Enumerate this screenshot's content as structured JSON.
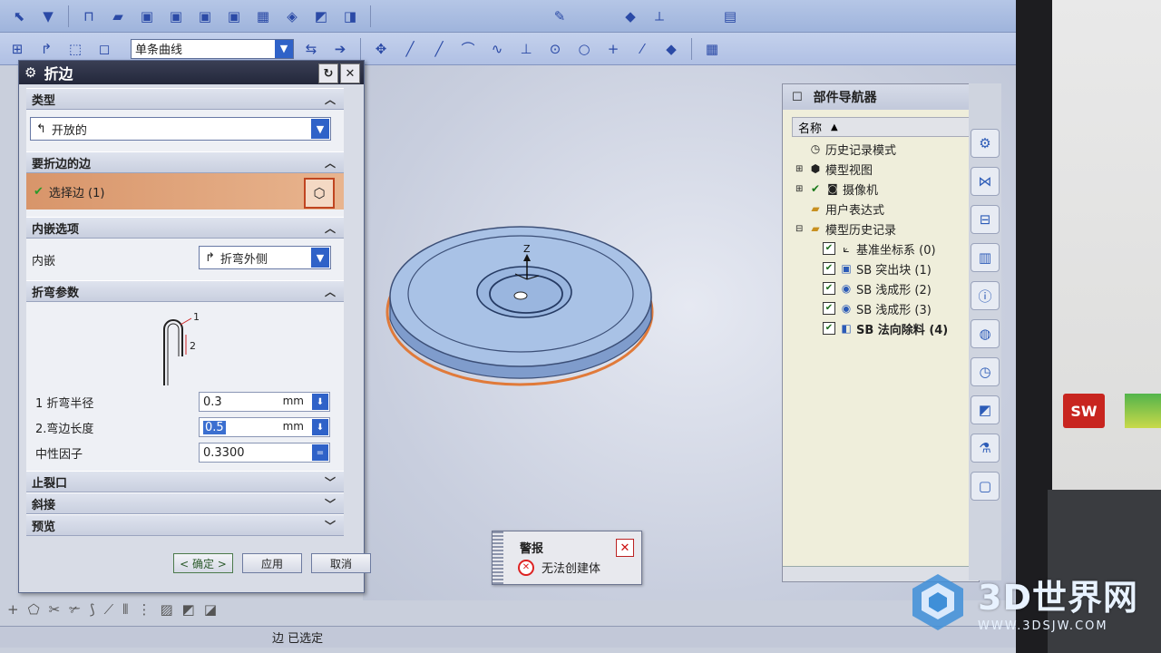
{
  "toolbar": {
    "curve_rule_value": "单条曲线"
  },
  "dialog": {
    "title": "折边",
    "sections": {
      "type": {
        "header": "类型",
        "value": "开放的"
      },
      "edge": {
        "header": "要折边的边",
        "select_label": "选择边 (1)"
      },
      "inset": {
        "header": "内嵌选项",
        "label": "内嵌",
        "value": "折弯外侧"
      },
      "bend": {
        "header": "折弯参数",
        "diagram_labels": [
          "1",
          "2"
        ],
        "params": [
          {
            "label": "1 折弯半径",
            "value": "0.3",
            "unit": "mm"
          },
          {
            "label": "2.弯边长度",
            "value": "0.5",
            "unit": "mm"
          },
          {
            "label": "中性因子",
            "value": "0.3300",
            "unit": ""
          }
        ]
      },
      "relief": {
        "header": "止裂口"
      },
      "miter": {
        "header": "斜接"
      },
      "preview": {
        "header": "预览"
      }
    },
    "buttons": {
      "ok": "< 确定 >",
      "apply": "应用",
      "cancel": "取消"
    }
  },
  "navigator": {
    "title": "部件导航器",
    "column_header": "名称",
    "items": [
      {
        "label": "历史记录模式",
        "level": 0
      },
      {
        "label": "模型视图",
        "level": 0
      },
      {
        "label": "摄像机",
        "level": 0
      },
      {
        "label": "用户表达式",
        "level": 0
      },
      {
        "label": "模型历史记录",
        "level": 0
      },
      {
        "label": "基准坐标系 (0)",
        "level": 1
      },
      {
        "label": "SB 突出块 (1)",
        "level": 1
      },
      {
        "label": "SB 浅成形 (2)",
        "level": 1
      },
      {
        "label": "SB 浅成形 (3)",
        "level": 1
      },
      {
        "label": "SB 法向除料 (4)",
        "level": 1
      }
    ]
  },
  "alert": {
    "title": "警报",
    "message": "无法创建体"
  },
  "viewport": {
    "axis_label": "Z"
  },
  "status_bar": {
    "text": "边 已选定"
  },
  "external": {
    "sw_badge": "SW"
  },
  "watermark": {
    "brand": "3D世界网",
    "url": "WWW.3DSJW.COM"
  },
  "colors": {
    "dialog_title": "#23273a",
    "selection_row": "#d8956a",
    "dropdown_accent": "#2f62c8",
    "alert_error": "#d22222",
    "part_body": "#9fb9e0"
  },
  "icons": [
    "gear-icon",
    "reset-icon",
    "close-icon",
    "cube-select-icon",
    "checkmark-icon",
    "error-icon",
    "folder-icon",
    "clock-icon",
    "camera-icon",
    "coordinate-icon"
  ]
}
